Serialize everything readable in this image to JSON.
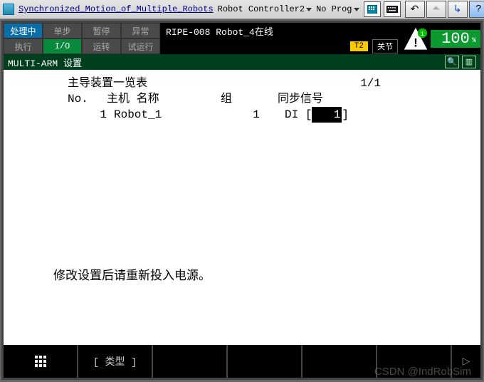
{
  "titlebar": {
    "app_title": "Synchronized_Motion_of_Multiple_Robots",
    "controller": "Robot Controller2",
    "program": "No Prog"
  },
  "status": {
    "row1": [
      "处理中",
      "单步",
      "暂停",
      "异常"
    ],
    "row2": [
      "执行",
      "I/O",
      "运转",
      "试运行"
    ],
    "message": "RIPE-008 Robot_4在线",
    "t_mode": "T2",
    "coord": "关节",
    "override": "100",
    "override_unit": "%"
  },
  "screen": {
    "title": "MULTI-ARM 设置",
    "list_title": "主导装置一览表",
    "page": "1/1",
    "columns": {
      "no": "No.",
      "host": "主机 名称",
      "group": "组",
      "sync": "同步信号"
    },
    "row": {
      "no": "1",
      "host": "Robot_1",
      "group": "1",
      "sig_type": "DI",
      "sig_open": "[",
      "sig_num": "1",
      "sig_close": "]"
    },
    "notice": "修改设置后请重新投入电源。"
  },
  "footer": {
    "f2": "[ 类型 ]"
  },
  "watermark": "CSDN @IndRobSim"
}
